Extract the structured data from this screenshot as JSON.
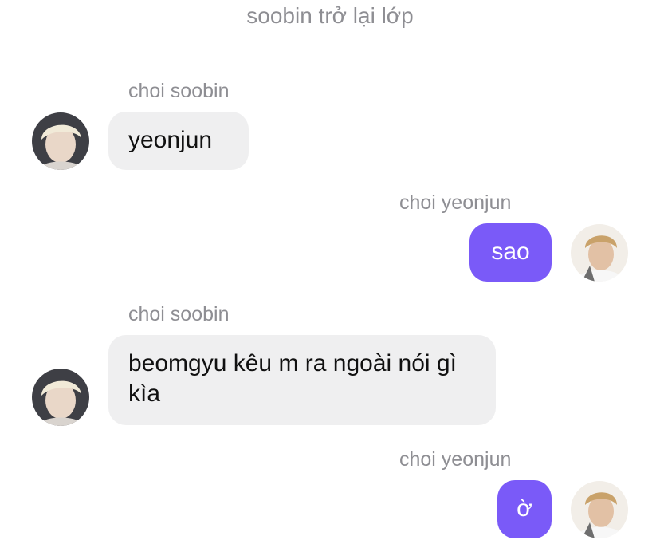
{
  "conversation": {
    "system_message": "soobin trở lại lớp"
  },
  "messages": [
    {
      "sender": "choi soobin",
      "text": "yeonjun",
      "side": "incoming",
      "avatar": "soobin-avatar"
    },
    {
      "sender": "choi yeonjun",
      "text": "sao",
      "side": "outgoing",
      "avatar": "yeonjun-avatar"
    },
    {
      "sender": "choi soobin",
      "text": "beomgyu kêu m ra ngoài nói gì kìa",
      "side": "incoming",
      "avatar": "soobin-avatar"
    },
    {
      "sender": "choi yeonjun",
      "text": "ờ",
      "side": "outgoing",
      "avatar": "yeonjun-avatar"
    }
  ],
  "colors": {
    "incoming_bubble": "#efeff0",
    "outgoing_bubble": "#7a5af8",
    "meta_text": "#8e8e93"
  }
}
